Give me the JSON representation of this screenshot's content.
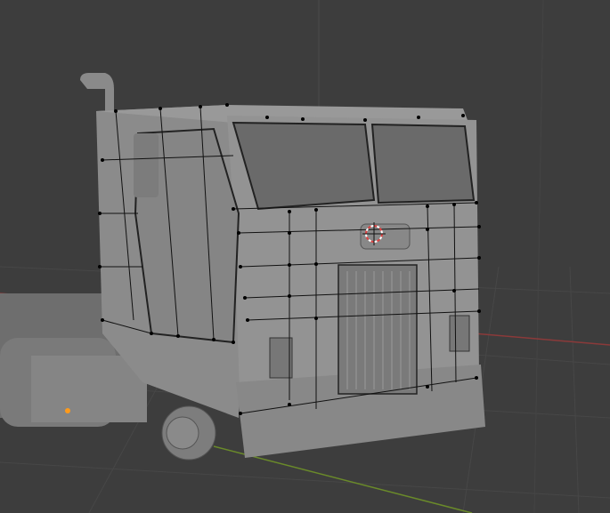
{
  "viewport": {
    "mode": "edit-mode-3d-viewport",
    "colors": {
      "background": "#3d3d3d",
      "grid": "#484848",
      "x_axis": "#8b3a3a",
      "y_axis": "#6a8a2a",
      "mesh": "#8c8c8c",
      "vertex": "#000000",
      "cursor_red": "#e04040",
      "origin": "#ff9a1a"
    }
  }
}
